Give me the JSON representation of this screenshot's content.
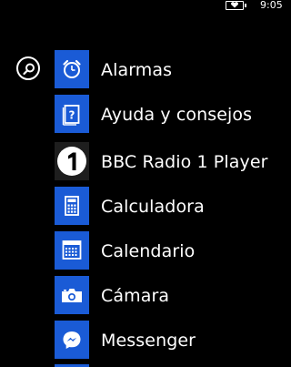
{
  "status_bar": {
    "time": "9:05",
    "battery_icon": "battery-charging-icon"
  },
  "search": {
    "icon": "search-icon"
  },
  "apps": [
    {
      "label": "Alarmas",
      "icon": "alarm-clock-icon",
      "tile_color": "#1a5bd6"
    },
    {
      "label": "Ayuda y consejos",
      "icon": "help-question-icon",
      "tile_color": "#1a5bd6"
    },
    {
      "label": "BBC Radio 1 Player",
      "icon": "bbc-radio-1-icon",
      "tile_color": "#1e1e1e"
    },
    {
      "label": "Calculadora",
      "icon": "calculator-icon",
      "tile_color": "#1a5bd6"
    },
    {
      "label": "Calendario",
      "icon": "calendar-icon",
      "tile_color": "#1a5bd6"
    },
    {
      "label": "Cámara",
      "icon": "camera-icon",
      "tile_color": "#1a5bd6"
    },
    {
      "label": "Messenger",
      "icon": "messenger-icon",
      "tile_color": "#1a5bd6"
    }
  ],
  "colors": {
    "background": "#000000",
    "accent": "#1a5bd6",
    "text": "#ffffff"
  }
}
